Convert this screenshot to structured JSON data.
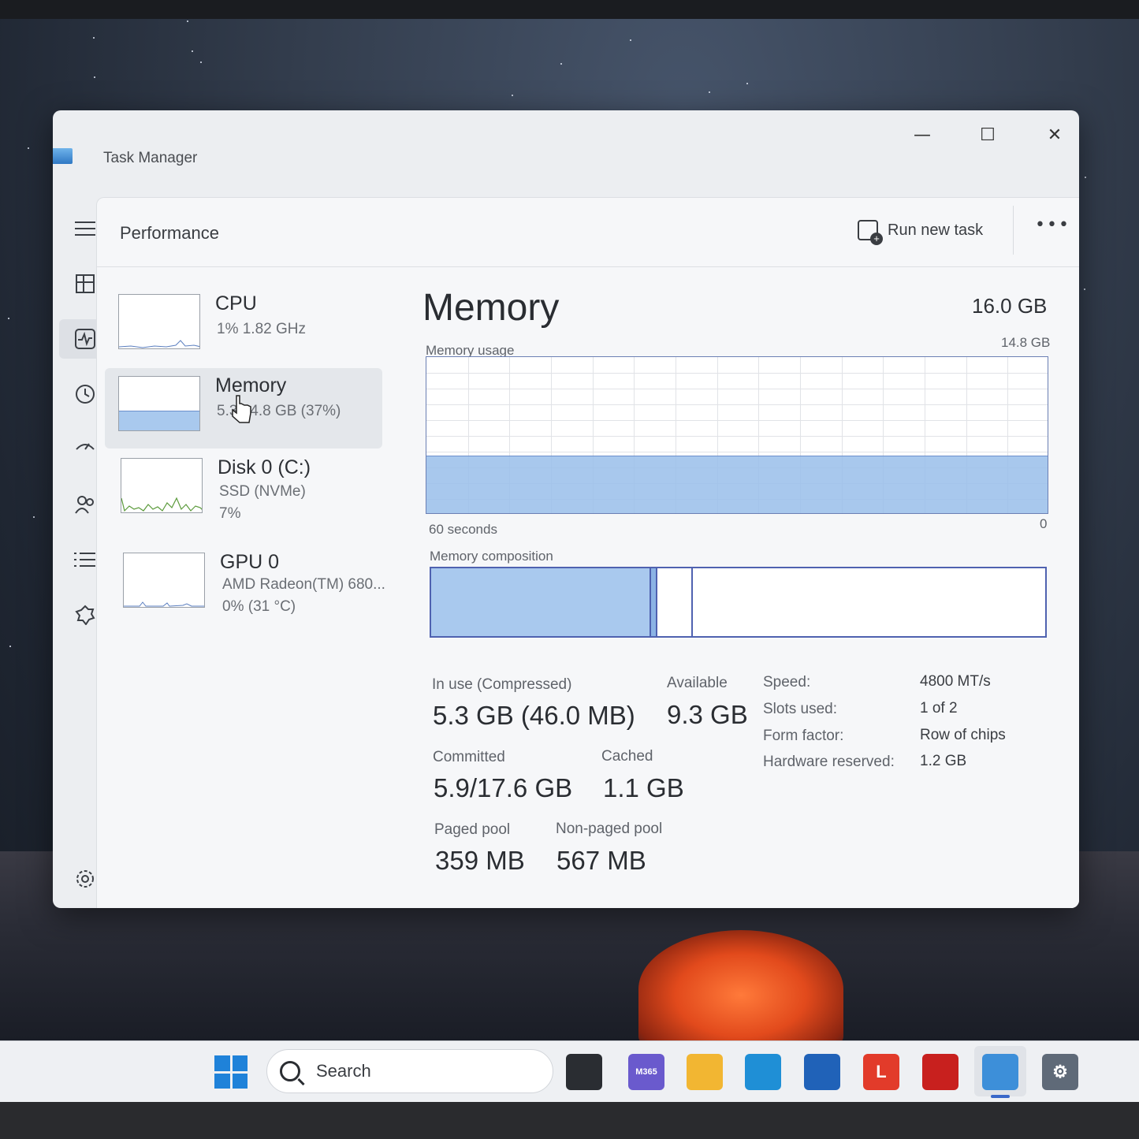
{
  "window": {
    "title": "Task Manager",
    "controls": {
      "minimize": "—",
      "maximize": "☐",
      "close": "✕"
    }
  },
  "header": {
    "page_title": "Performance",
    "run_new_task": "Run new task",
    "more": "•••"
  },
  "nav": {
    "icons": [
      "hamburger-menu-icon",
      "processes-icon",
      "performance-icon",
      "app-history-icon",
      "startup-apps-icon",
      "users-icon",
      "details-icon",
      "services-icon",
      "settings-icon"
    ],
    "active": "performance-icon"
  },
  "resources": [
    {
      "name": "CPU",
      "sub1": "1%  1.82 GHz",
      "sub2": ""
    },
    {
      "name": "Memory",
      "sub1": "5.3/14.8 GB (37%)",
      "sub2": ""
    },
    {
      "name": "Disk 0 (C:)",
      "sub1": "SSD (NVMe)",
      "sub2": "7%"
    },
    {
      "name": "GPU 0",
      "sub1": "AMD Radeon(TM) 680...",
      "sub2": "0%  (31 °C)"
    }
  ],
  "memory": {
    "title": "Memory",
    "total": "16.0 GB",
    "usage_label": "Memory usage",
    "usage_max": "14.8 GB",
    "time_label": "60 seconds",
    "time_end": "0",
    "usage_fraction": 0.37,
    "composition_label": "Memory composition",
    "composition": {
      "in_use": 5.3,
      "modified": 0.1,
      "standby": 1.1,
      "free": 8.3
    },
    "stats": {
      "in_use_label": "In use (Compressed)",
      "in_use_value": "5.3 GB (46.0 MB)",
      "available_label": "Available",
      "available_value": "9.3 GB",
      "committed_label": "Committed",
      "committed_value": "5.9/17.6 GB",
      "cached_label": "Cached",
      "cached_value": "1.1 GB",
      "paged_label": "Paged pool",
      "paged_value": "359 MB",
      "nonpaged_label": "Non-paged pool",
      "nonpaged_value": "567 MB"
    },
    "details": [
      {
        "key": "Speed:",
        "value": "4800 MT/s"
      },
      {
        "key": "Slots used:",
        "value": "1 of 2"
      },
      {
        "key": "Form factor:",
        "value": "Row of chips"
      },
      {
        "key": "Hardware reserved:",
        "value": "1.2 GB"
      }
    ]
  },
  "taskbar": {
    "search_placeholder": "Search",
    "apps": [
      {
        "name": "task-view-icon",
        "label": "",
        "color": "#2a2d32"
      },
      {
        "name": "m365-copilot-icon",
        "label": "M365",
        "color": "#6a5acd"
      },
      {
        "name": "file-explorer-icon",
        "label": "",
        "color": "#f2b632"
      },
      {
        "name": "edge-icon",
        "label": "",
        "color": "#1f8fd6"
      },
      {
        "name": "store-icon",
        "label": "",
        "color": "#2062b8"
      },
      {
        "name": "lenovo-icon",
        "label": "L",
        "color": "#e23b2a"
      },
      {
        "name": "mcafee-icon",
        "label": "",
        "color": "#c8201e"
      },
      {
        "name": "task-manager-icon",
        "label": "",
        "color": "#3d8fd9"
      },
      {
        "name": "settings-app-icon",
        "label": "⚙",
        "color": "#5f6a78"
      }
    ]
  }
}
